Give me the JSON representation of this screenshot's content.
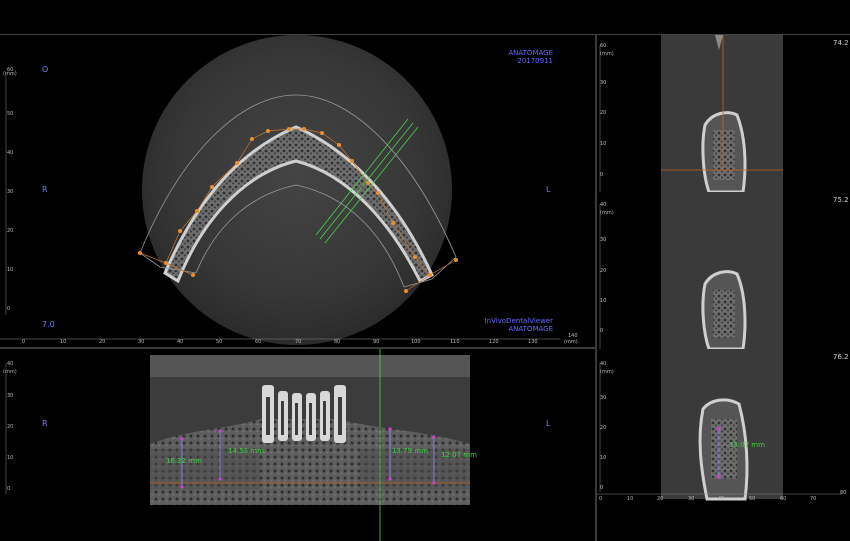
{
  "topbar": {},
  "axial": {
    "watermark_top": [
      "ANATOMAGE",
      "20170911"
    ],
    "watermark_bottom": [
      "InVivoDentalViewer",
      "ANATOMAGE"
    ],
    "orientation": {
      "top": "O",
      "right": "L",
      "left": "R"
    },
    "slice": "7.0",
    "ruler_unit": "(mm)",
    "y_ticks": [
      "60",
      "50",
      "40",
      "30",
      "20",
      "10",
      "0"
    ],
    "x_ticks": [
      "0",
      "10",
      "20",
      "30",
      "40",
      "50",
      "60",
      "70",
      "80",
      "90",
      "100",
      "110",
      "120",
      "130"
    ],
    "x_end": "140"
  },
  "panoramic": {
    "orientation": {
      "left": "R",
      "right": "L"
    },
    "ruler_unit": "(mm)",
    "y_ticks": [
      "40",
      "30",
      "20",
      "10",
      "0"
    ],
    "measurements": [
      "16.32 mm",
      "14.53 mm",
      "13.79 mm",
      "12.07 mm"
    ]
  },
  "cross_sections": [
    {
      "slice": "74.2",
      "y_top": "60",
      "unit": "(mm)",
      "y_ticks": [
        "30",
        "20",
        "10",
        "0"
      ]
    },
    {
      "slice": "75.2",
      "y_top": "40",
      "unit": "(mm)",
      "y_ticks": [
        "30",
        "20",
        "10",
        "0"
      ]
    },
    {
      "slice": "76.2",
      "y_top": "40",
      "unit": "(mm)",
      "y_ticks": [
        "30",
        "20",
        "10",
        "0"
      ],
      "measurement": "15.07 mm",
      "x_ticks": [
        "0",
        "10",
        "20",
        "30",
        "40",
        "50",
        "60",
        "70"
      ],
      "x_end": "80"
    }
  ]
}
